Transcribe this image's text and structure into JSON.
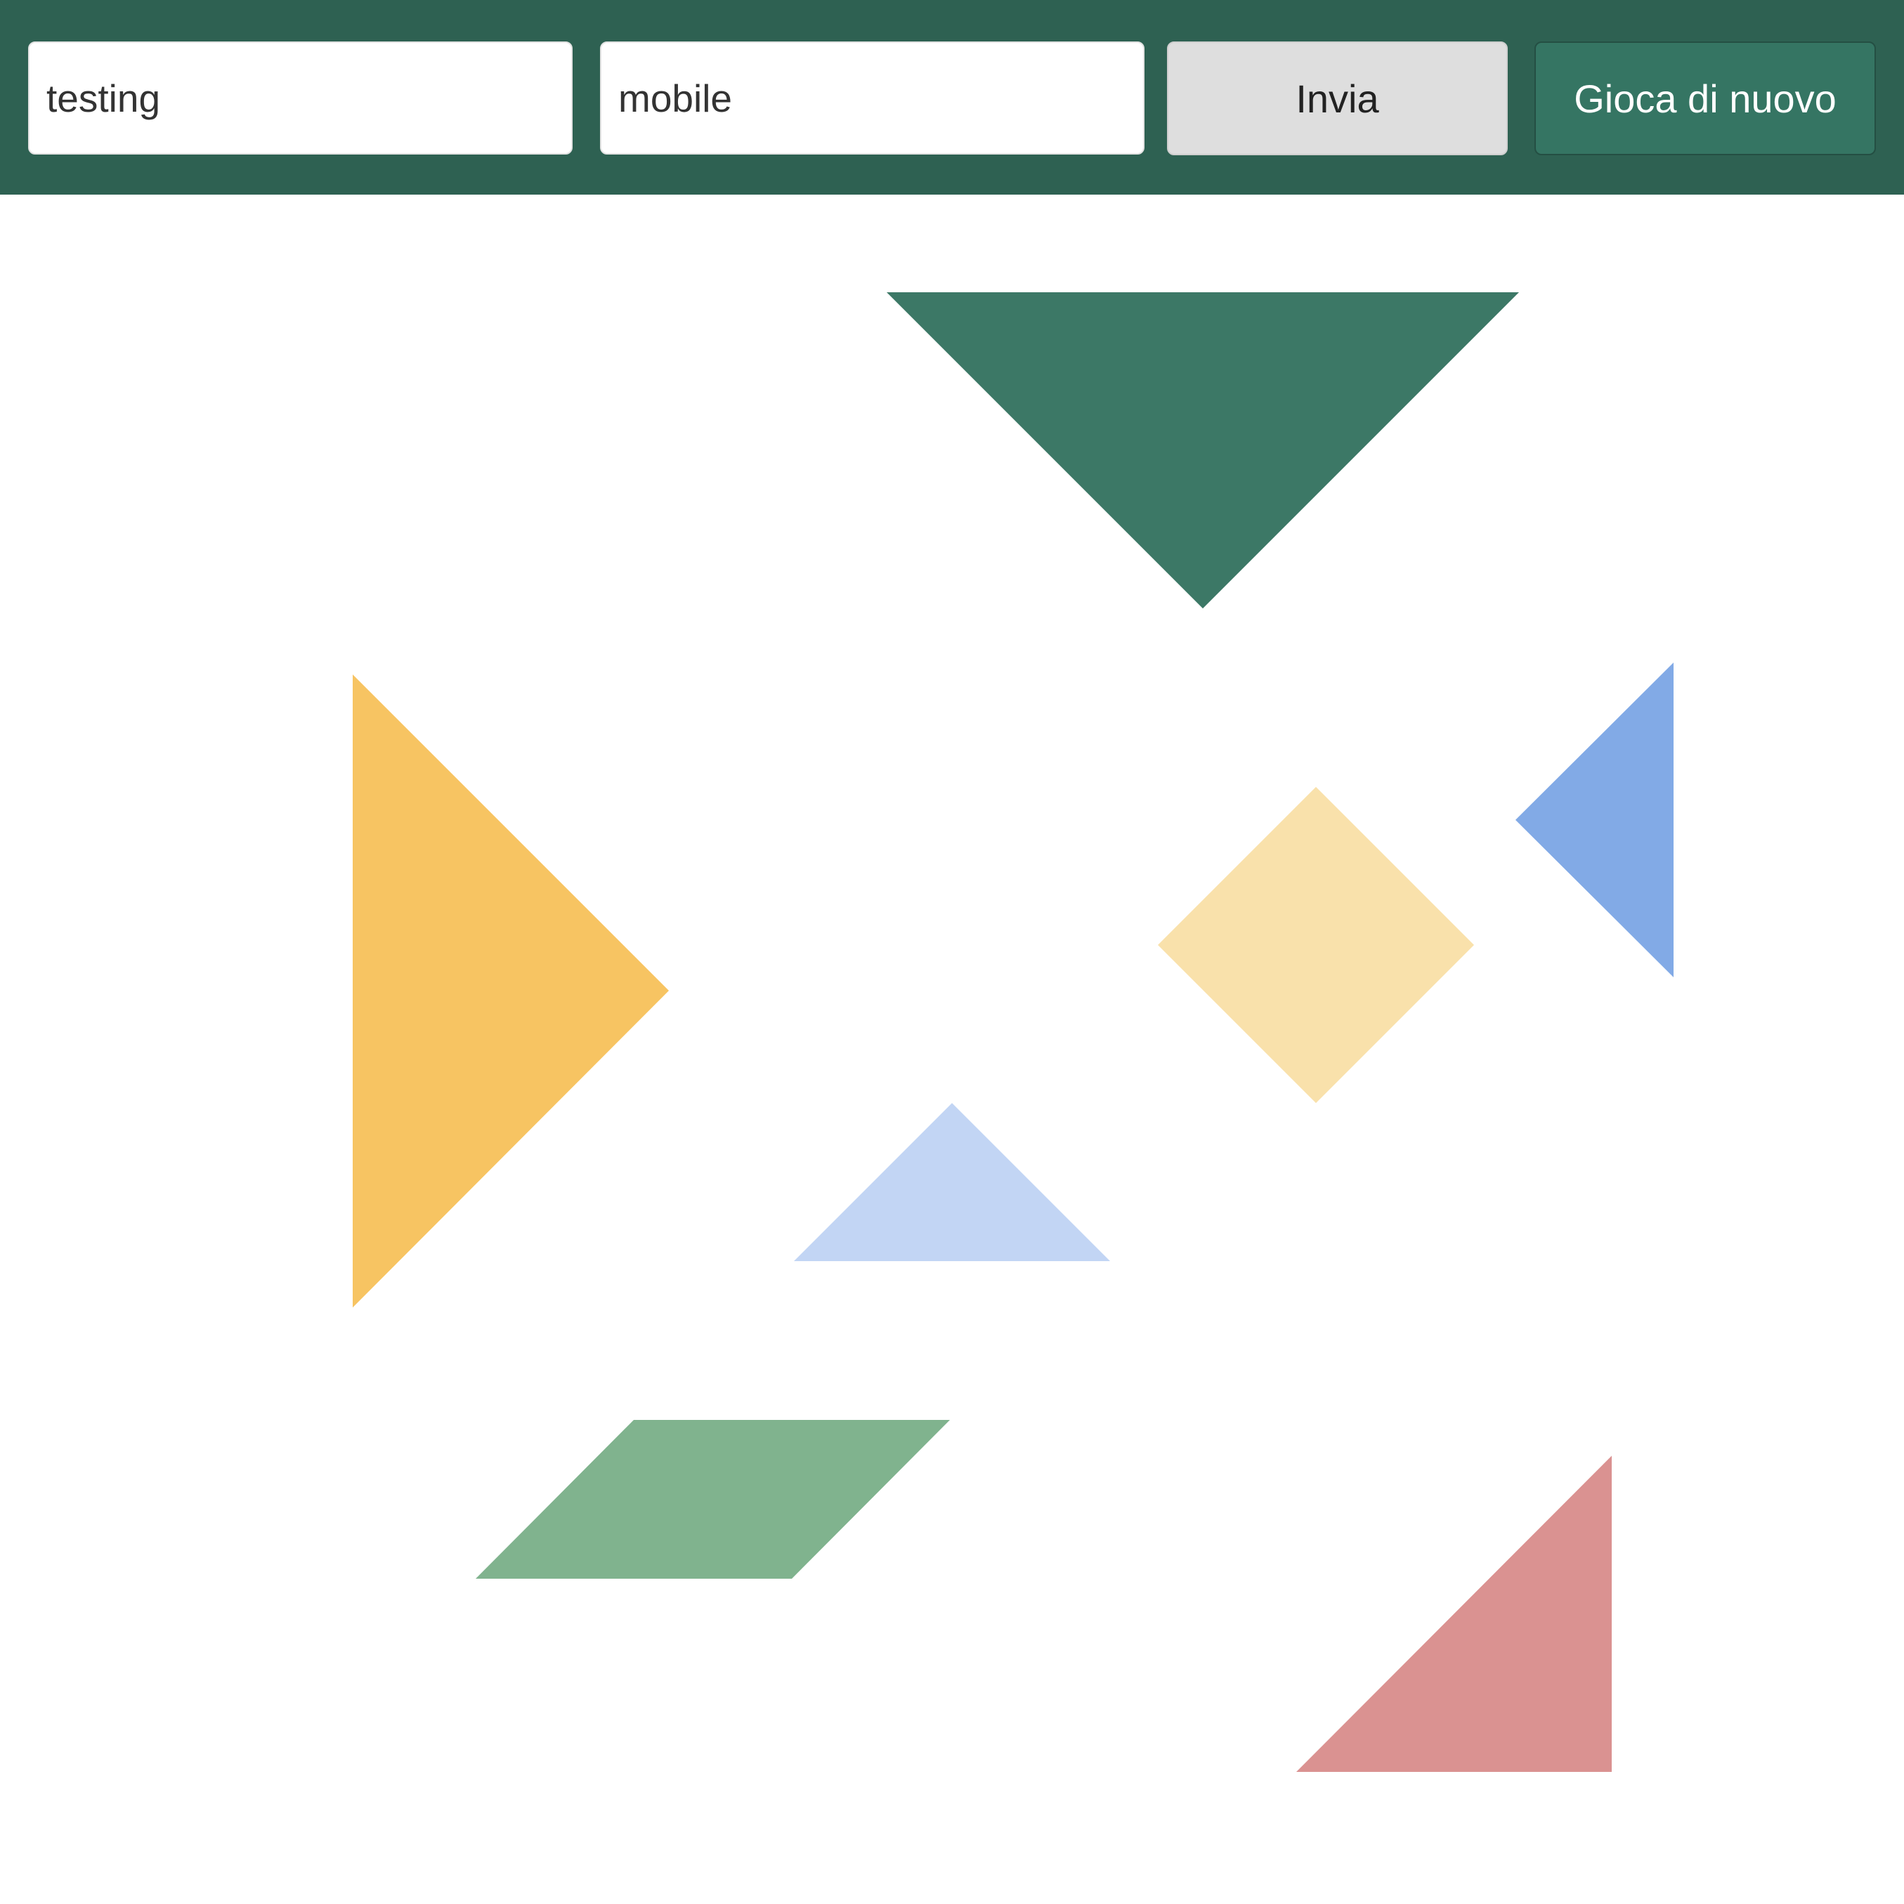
{
  "header": {
    "word1": {
      "value": "testing"
    },
    "word2": {
      "value": "mobile"
    },
    "send_label": "Invia",
    "replay_label": "Gioca di nuovo"
  },
  "colors": {
    "header_bg": "#2e6152",
    "replay_button": "#357563",
    "send_button": "#dedede"
  },
  "pieces": [
    {
      "name": "large-triangle-dark-green",
      "shape": "large-triangle",
      "color": "#3c7866"
    },
    {
      "name": "large-triangle-orange",
      "shape": "large-triangle",
      "color": "#f7c462"
    },
    {
      "name": "square-light-yellow",
      "shape": "square",
      "color": "#f9e1ab"
    },
    {
      "name": "small-triangle-blue",
      "shape": "small-triangle",
      "color": "#82aae6"
    },
    {
      "name": "small-triangle-light-blue",
      "shape": "small-triangle",
      "color": "#c2d5f4"
    },
    {
      "name": "parallelogram-green",
      "shape": "parallelogram",
      "color": "#80b38e"
    },
    {
      "name": "medium-triangle-pink",
      "shape": "medium-triangle",
      "color": "#da9291"
    }
  ]
}
